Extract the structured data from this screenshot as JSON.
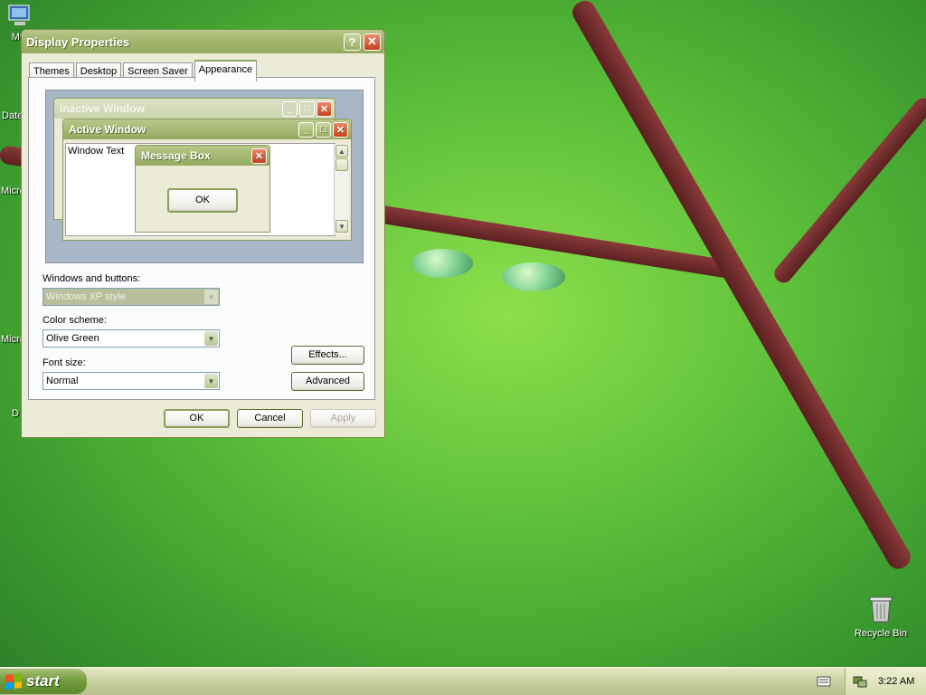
{
  "desktop": {
    "icons": [
      {
        "name": "my-computer",
        "label": "My"
      },
      {
        "name": "data",
        "label": "Date"
      },
      {
        "name": "microsoft-1",
        "label": "Micro"
      },
      {
        "name": "microsoft-2",
        "label": "Micre"
      },
      {
        "name": "d-item",
        "label": "D"
      }
    ],
    "recycle_bin_label": "Recycle Bin"
  },
  "dialog": {
    "title": "Display Properties",
    "help_glyph": "?",
    "close_glyph": "✕",
    "tabs": [
      {
        "label": "Themes"
      },
      {
        "label": "Desktop"
      },
      {
        "label": "Screen Saver"
      },
      {
        "label": "Appearance",
        "active": true
      }
    ],
    "preview": {
      "inactive_title": "Inactive Window",
      "active_title": "Active Window",
      "window_text": "Window Text",
      "message_box_title": "Message Box",
      "ok_label": "OK"
    },
    "fields": {
      "windows_buttons_label": "Windows and buttons:",
      "windows_buttons_value": "Windows XP style",
      "color_scheme_label": "Color scheme:",
      "color_scheme_value": "Olive Green",
      "font_size_label": "Font size:",
      "font_size_value": "Normal"
    },
    "buttons": {
      "effects": "Effects...",
      "advanced": "Advanced",
      "ok": "OK",
      "cancel": "Cancel",
      "apply": "Apply"
    }
  },
  "taskbar": {
    "start_label": "start",
    "clock": "3:22 AM"
  },
  "colors": {
    "accent_olive": "#96aa5e",
    "close_red": "#c83f20"
  }
}
